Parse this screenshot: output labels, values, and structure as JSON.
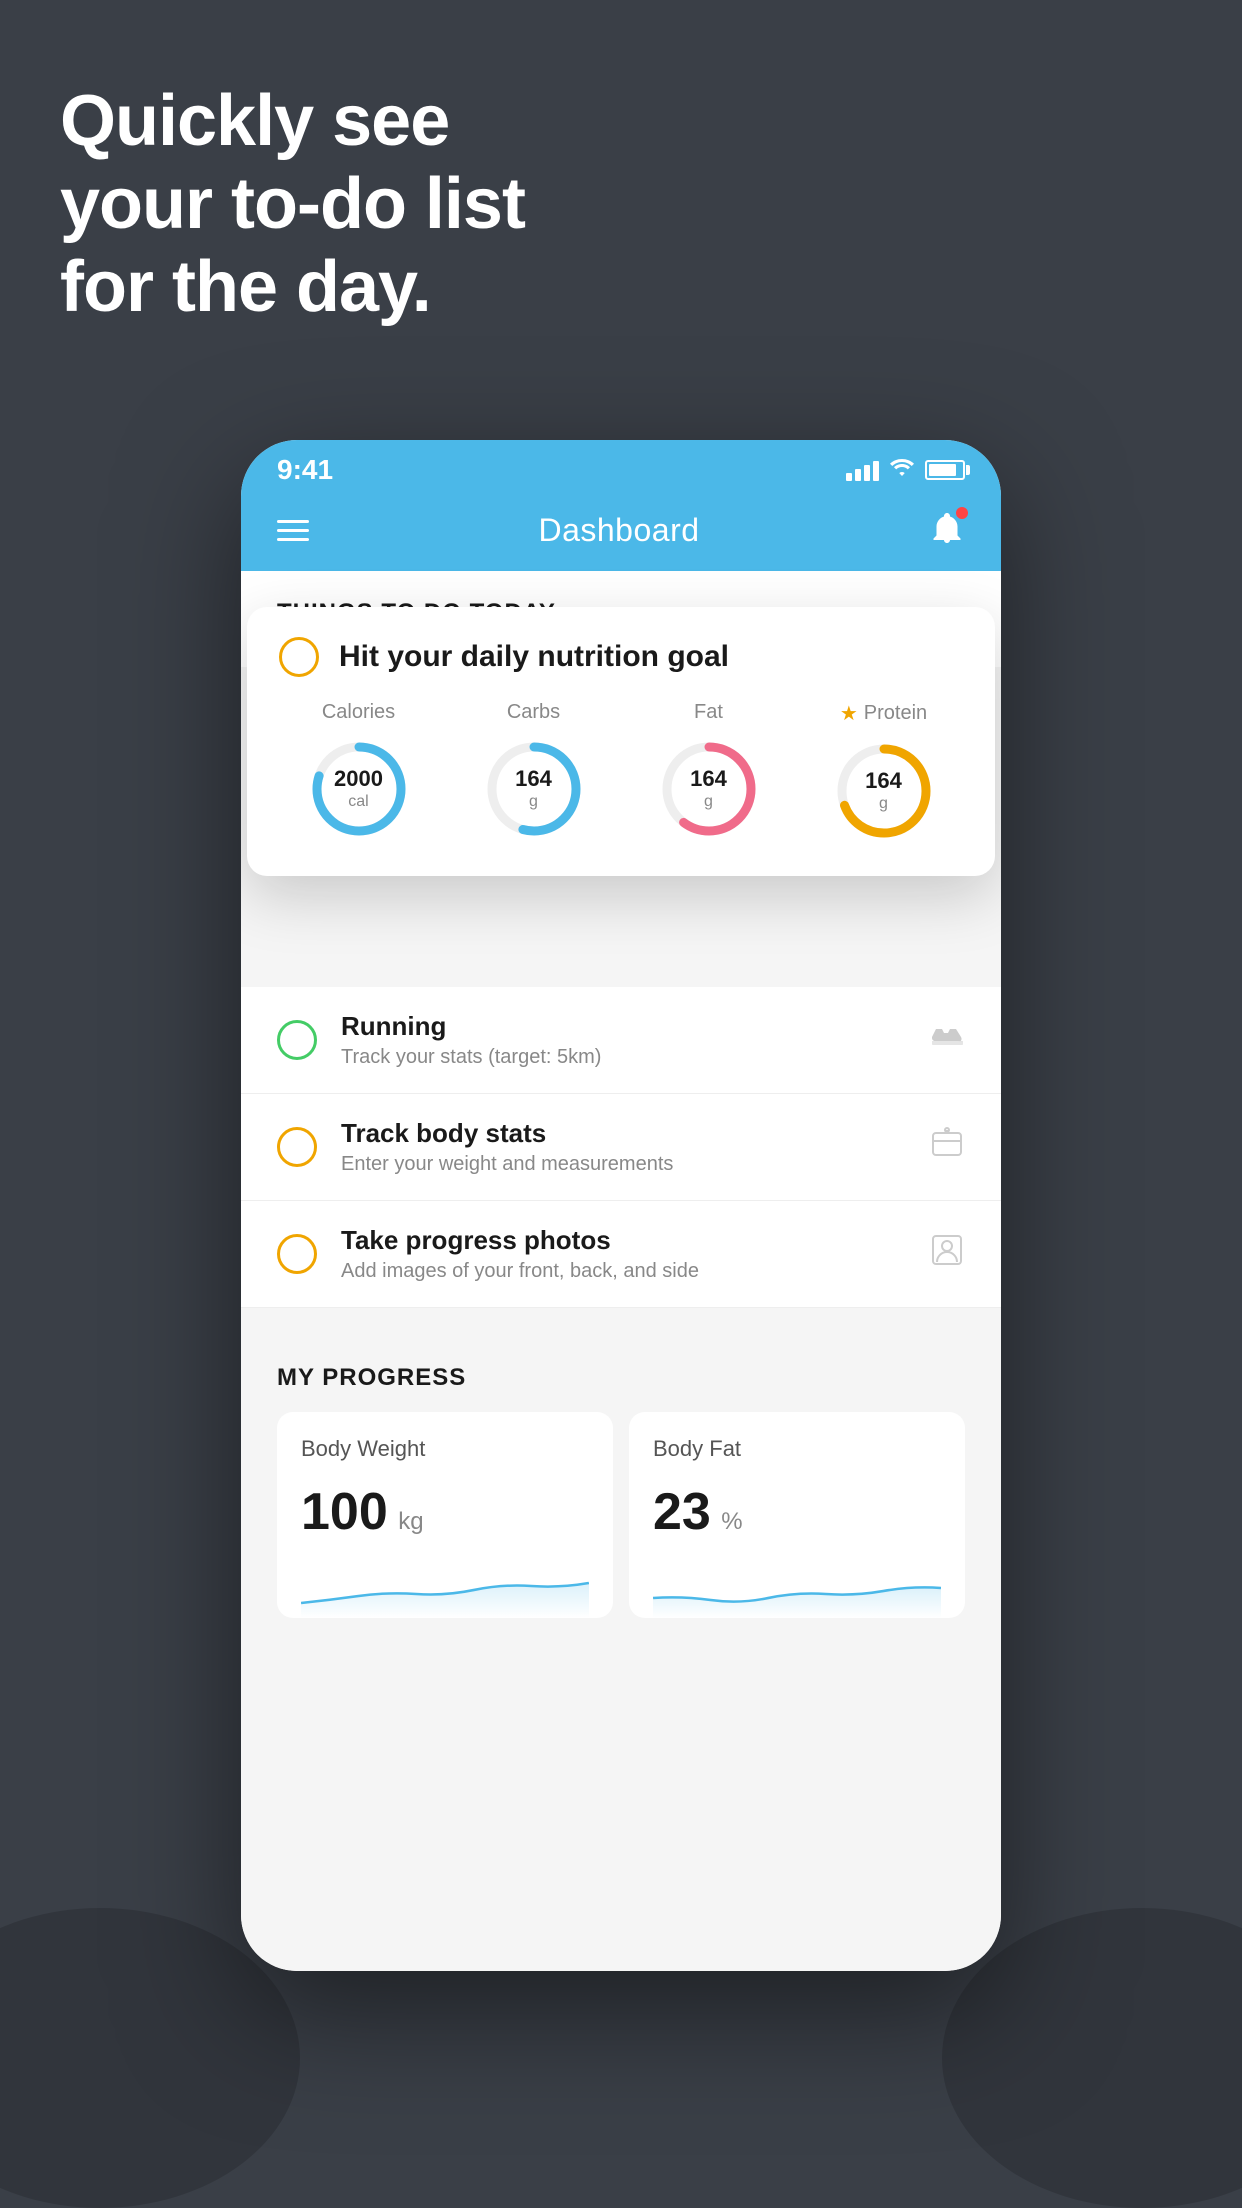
{
  "background_color": "#3a3f47",
  "headline": {
    "line1": "Quickly see",
    "line2": "your to-do list",
    "line3": "for the day."
  },
  "status_bar": {
    "time": "9:41",
    "signal": "signal",
    "wifi": "wifi",
    "battery": "battery"
  },
  "header": {
    "title": "Dashboard",
    "menu_icon": "hamburger",
    "notification_icon": "bell"
  },
  "things_to_do": {
    "section_title": "THINGS TO DO TODAY",
    "featured_card": {
      "checkbox_state": "empty",
      "title": "Hit your daily nutrition goal",
      "nutrition": [
        {
          "label": "Calories",
          "value": "2000",
          "unit": "cal",
          "color": "blue",
          "starred": false
        },
        {
          "label": "Carbs",
          "value": "164",
          "unit": "g",
          "color": "blue",
          "starred": false
        },
        {
          "label": "Fat",
          "value": "164",
          "unit": "g",
          "color": "pink",
          "starred": false
        },
        {
          "label": "Protein",
          "value": "164",
          "unit": "g",
          "color": "yellow",
          "starred": true
        }
      ]
    },
    "items": [
      {
        "id": "running",
        "title": "Running",
        "subtitle": "Track your stats (target: 5km)",
        "checkbox_color": "green",
        "icon": "shoe"
      },
      {
        "id": "body-stats",
        "title": "Track body stats",
        "subtitle": "Enter your weight and measurements",
        "checkbox_color": "yellow",
        "icon": "scale"
      },
      {
        "id": "progress-photos",
        "title": "Take progress photos",
        "subtitle": "Add images of your front, back, and side",
        "checkbox_color": "yellow",
        "icon": "person"
      }
    ]
  },
  "my_progress": {
    "section_title": "MY PROGRESS",
    "cards": [
      {
        "id": "body-weight",
        "title": "Body Weight",
        "value": "100",
        "unit": "kg"
      },
      {
        "id": "body-fat",
        "title": "Body Fat",
        "value": "23",
        "unit": "%"
      }
    ]
  }
}
